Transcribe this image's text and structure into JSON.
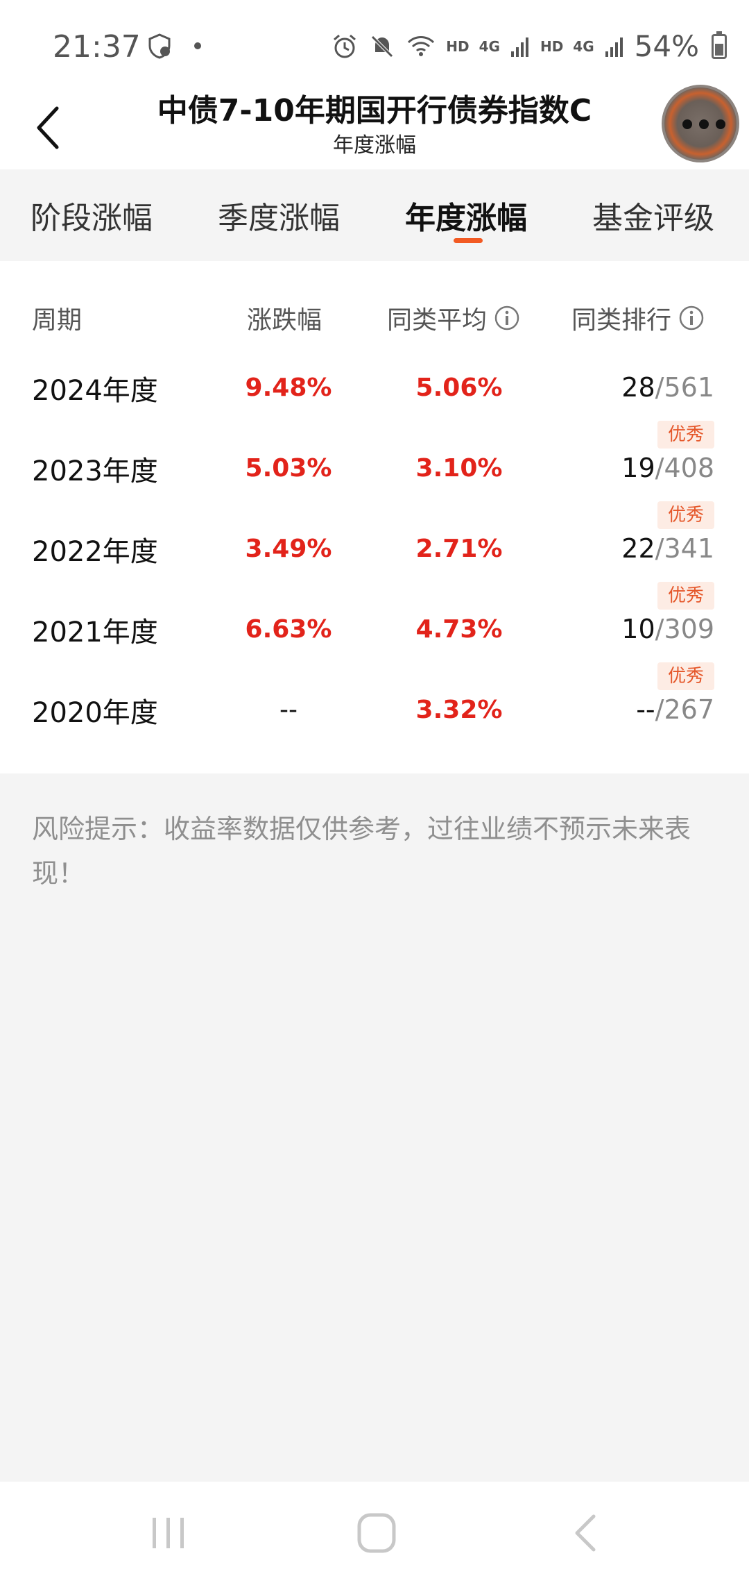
{
  "status_bar": {
    "time": "21:37",
    "hd1": "HD",
    "net1": "4G",
    "hd2": "HD",
    "net2": "4G",
    "battery_text": "54%"
  },
  "header": {
    "title": "中债7-10年期国开行债券指数C",
    "subtitle": "年度涨幅"
  },
  "tabs": [
    {
      "label": "阶段涨幅"
    },
    {
      "label": "季度涨幅"
    },
    {
      "label": "年度涨幅"
    },
    {
      "label": "基金评级"
    }
  ],
  "active_tab_index": 2,
  "table": {
    "headers": {
      "period": "周期",
      "change": "涨跌幅",
      "avg": "同类平均",
      "rank": "同类排行"
    },
    "rows": [
      {
        "period": "2024年度",
        "change": "9.48%",
        "avg": "5.06%",
        "rank": "28",
        "total": "/561",
        "badge": "优秀"
      },
      {
        "period": "2023年度",
        "change": "5.03%",
        "avg": "3.10%",
        "rank": "19",
        "total": "/408",
        "badge": "优秀"
      },
      {
        "period": "2022年度",
        "change": "3.49%",
        "avg": "2.71%",
        "rank": "22",
        "total": "/341",
        "badge": "优秀"
      },
      {
        "period": "2021年度",
        "change": "6.63%",
        "avg": "4.73%",
        "rank": "10",
        "total": "/309",
        "badge": "优秀"
      },
      {
        "period": "2020年度",
        "change": "--",
        "avg": "3.32%",
        "rank": "--",
        "total": "/267",
        "badge": ""
      }
    ]
  },
  "risk_note": "风险提示：收益率数据仅供参考，过往业绩不预示未来表现！",
  "colors": {
    "accent": "#f25a23",
    "positive": "#e2231a",
    "badge_bg": "#fdece4",
    "badge_text": "#e5572a"
  }
}
